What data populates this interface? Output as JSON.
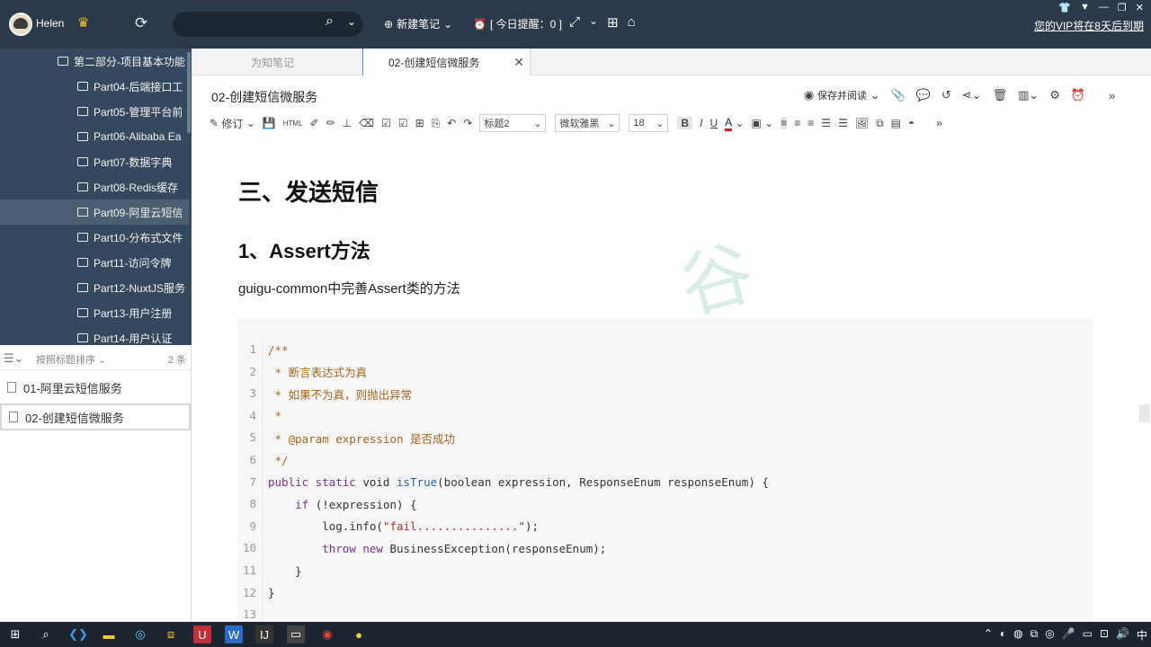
{
  "app": {
    "username": "Helen",
    "search_placeholder": "",
    "new_note_label": "新建笔记",
    "reminder_label": "[ 今日提醒：0 ]",
    "vip_notice": "您的VIP将在8天后到期"
  },
  "sidebar": {
    "tree_items": [
      {
        "label": "第二部分-项目基本功能",
        "indent": 1,
        "active": false
      },
      {
        "label": "Part04-后端接口工",
        "indent": 2,
        "active": false
      },
      {
        "label": "Part05-管理平台前",
        "indent": 2,
        "active": false
      },
      {
        "label": "Part06-Alibaba Ea",
        "indent": 2,
        "active": false
      },
      {
        "label": "Part07-数据字典",
        "indent": 2,
        "active": false
      },
      {
        "label": "Part08-Redis缓存",
        "indent": 2,
        "active": false
      },
      {
        "label": "Part09-阿里云短信",
        "indent": 2,
        "active": true
      },
      {
        "label": "Part10-分布式文件",
        "indent": 2,
        "active": false
      },
      {
        "label": "Part11-访问令牌",
        "indent": 2,
        "active": false
      },
      {
        "label": "Part12-NuxtJS服务",
        "indent": 2,
        "active": false
      },
      {
        "label": "Part13-用户注册",
        "indent": 2,
        "active": false
      },
      {
        "label": "Part14-用户认证",
        "indent": 2,
        "active": false
      }
    ],
    "sort_label": "按照标题排序",
    "count_label": "2 条",
    "notes": [
      {
        "label": "01-阿里云短信服务",
        "selected": false
      },
      {
        "label": "02-创建短信微服务",
        "selected": true
      }
    ]
  },
  "tabs": [
    {
      "label": "为知笔记",
      "active": false
    },
    {
      "label": "02-创建短信微服务",
      "active": true
    }
  ],
  "editor": {
    "doc_title": "02-创建短信微服务",
    "save_read_label": "保存并阅读",
    "revise_label": "修订",
    "style_select": "标题2",
    "font_select": "微软雅黑",
    "size_select": "18"
  },
  "content": {
    "h1": "三、发送短信",
    "h2": "1、Assert方法",
    "para": "guigu-common中完善Assert类的方法",
    "watermark": "谷"
  },
  "code": [
    {
      "n": "1",
      "parts": [
        {
          "t": "/**",
          "c": "c-com"
        }
      ]
    },
    {
      "n": "2",
      "parts": [
        {
          "t": " * 断言表达式为真",
          "c": "c-com"
        }
      ]
    },
    {
      "n": "3",
      "parts": [
        {
          "t": " * 如果不为真，则抛出异常",
          "c": "c-com"
        }
      ]
    },
    {
      "n": "4",
      "parts": [
        {
          "t": " *",
          "c": "c-com"
        }
      ]
    },
    {
      "n": "5",
      "parts": [
        {
          "t": " * @param expression 是否成功",
          "c": "c-com"
        }
      ]
    },
    {
      "n": "6",
      "parts": [
        {
          "t": " */",
          "c": "c-com"
        }
      ]
    },
    {
      "n": "7",
      "parts": [
        {
          "t": "public static ",
          "c": "c-kw"
        },
        {
          "t": "void ",
          "c": ""
        },
        {
          "t": "isTrue",
          "c": "c-fn"
        },
        {
          "t": "(boolean expression, ResponseEnum responseEnum) {",
          "c": ""
        }
      ]
    },
    {
      "n": "8",
      "parts": [
        {
          "t": "    ",
          "c": ""
        },
        {
          "t": "if",
          "c": "c-kw"
        },
        {
          "t": " (!expression) {",
          "c": ""
        }
      ]
    },
    {
      "n": "9",
      "parts": [
        {
          "t": "        log.info(",
          "c": ""
        },
        {
          "t": "\"fail...............\"",
          "c": "c-str"
        },
        {
          "t": ");",
          "c": ""
        }
      ]
    },
    {
      "n": "10",
      "parts": [
        {
          "t": "        ",
          "c": ""
        },
        {
          "t": "throw new ",
          "c": "c-kw"
        },
        {
          "t": "BusinessException(responseEnum);",
          "c": ""
        }
      ]
    },
    {
      "n": "11",
      "parts": [
        {
          "t": "    }",
          "c": ""
        }
      ]
    },
    {
      "n": "12",
      "parts": [
        {
          "t": "}",
          "c": ""
        }
      ]
    },
    {
      "n": "13",
      "parts": [
        {
          "t": "",
          "c": ""
        }
      ]
    }
  ],
  "tray": {
    "ime": "中"
  }
}
